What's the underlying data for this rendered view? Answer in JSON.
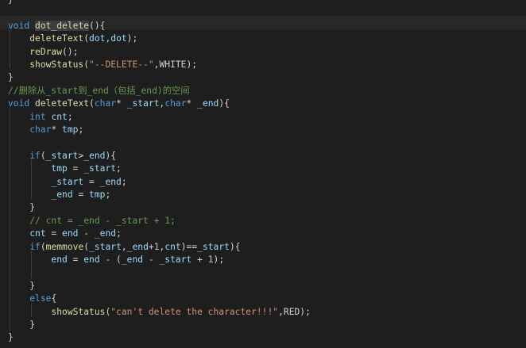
{
  "lines": [
    {
      "tokens": [
        {
          "t": "}",
          "c": "op"
        }
      ]
    },
    {
      "tokens": []
    },
    {
      "tokens": [
        {
          "t": "void",
          "c": "kw"
        },
        {
          "t": " ",
          "c": "op"
        },
        {
          "t": "dot_delete",
          "c": "fn hlword"
        },
        {
          "t": "(){",
          "c": "op"
        }
      ]
    },
    {
      "tokens": [
        {
          "t": "    ",
          "c": "op"
        },
        {
          "t": "deleteText",
          "c": "fn"
        },
        {
          "t": "(",
          "c": "op"
        },
        {
          "t": "dot",
          "c": "var"
        },
        {
          "t": ",",
          "c": "op"
        },
        {
          "t": "dot",
          "c": "var"
        },
        {
          "t": ");",
          "c": "op"
        }
      ]
    },
    {
      "tokens": [
        {
          "t": "    ",
          "c": "op"
        },
        {
          "t": "reDraw",
          "c": "fn"
        },
        {
          "t": "();",
          "c": "op"
        }
      ]
    },
    {
      "tokens": [
        {
          "t": "    ",
          "c": "op"
        },
        {
          "t": "showStatus",
          "c": "fn"
        },
        {
          "t": "(",
          "c": "op"
        },
        {
          "t": "\"--DELETE--\"",
          "c": "str"
        },
        {
          "t": ",WHITE);",
          "c": "op"
        }
      ]
    },
    {
      "tokens": [
        {
          "t": "}",
          "c": "op"
        }
      ]
    },
    {
      "tokens": [
        {
          "t": "//删除从_start到_end（包括_end)的空间",
          "c": "cm"
        }
      ]
    },
    {
      "tokens": [
        {
          "t": "void",
          "c": "kw"
        },
        {
          "t": " ",
          "c": "op"
        },
        {
          "t": "deleteText",
          "c": "fn"
        },
        {
          "t": "(",
          "c": "op"
        },
        {
          "t": "char",
          "c": "kw"
        },
        {
          "t": "* ",
          "c": "op"
        },
        {
          "t": "_start",
          "c": "var"
        },
        {
          "t": ",",
          "c": "op"
        },
        {
          "t": "char",
          "c": "kw"
        },
        {
          "t": "* ",
          "c": "op"
        },
        {
          "t": "_end",
          "c": "var"
        },
        {
          "t": "){",
          "c": "op"
        }
      ]
    },
    {
      "tokens": [
        {
          "t": "    ",
          "c": "op"
        },
        {
          "t": "int",
          "c": "kw"
        },
        {
          "t": " ",
          "c": "op"
        },
        {
          "t": "cnt",
          "c": "var"
        },
        {
          "t": ";",
          "c": "op"
        }
      ]
    },
    {
      "tokens": [
        {
          "t": "    ",
          "c": "op"
        },
        {
          "t": "char",
          "c": "kw"
        },
        {
          "t": "* ",
          "c": "op"
        },
        {
          "t": "tmp",
          "c": "var"
        },
        {
          "t": ";",
          "c": "op"
        }
      ]
    },
    {
      "tokens": []
    },
    {
      "tokens": [
        {
          "t": "    ",
          "c": "op"
        },
        {
          "t": "if",
          "c": "kw"
        },
        {
          "t": "(",
          "c": "op"
        },
        {
          "t": "_start",
          "c": "var"
        },
        {
          "t": ">",
          "c": "op"
        },
        {
          "t": "_end",
          "c": "var"
        },
        {
          "t": "){",
          "c": "op"
        }
      ]
    },
    {
      "tokens": [
        {
          "t": "        ",
          "c": "op"
        },
        {
          "t": "tmp",
          "c": "var"
        },
        {
          "t": " = ",
          "c": "op"
        },
        {
          "t": "_start",
          "c": "var"
        },
        {
          "t": ";",
          "c": "op"
        }
      ]
    },
    {
      "tokens": [
        {
          "t": "        ",
          "c": "op"
        },
        {
          "t": "_start",
          "c": "var"
        },
        {
          "t": " = ",
          "c": "op"
        },
        {
          "t": "_end",
          "c": "var"
        },
        {
          "t": ";",
          "c": "op"
        }
      ]
    },
    {
      "tokens": [
        {
          "t": "        ",
          "c": "op"
        },
        {
          "t": "_end",
          "c": "var"
        },
        {
          "t": " = ",
          "c": "op"
        },
        {
          "t": "tmp",
          "c": "var"
        },
        {
          "t": ";",
          "c": "op"
        }
      ]
    },
    {
      "tokens": [
        {
          "t": "    ",
          "c": "op"
        },
        {
          "t": "}",
          "c": "op"
        }
      ]
    },
    {
      "tokens": [
        {
          "t": "    ",
          "c": "op"
        },
        {
          "t": "// cnt = _end - _start + 1;",
          "c": "cm"
        }
      ]
    },
    {
      "tokens": [
        {
          "t": "    ",
          "c": "op"
        },
        {
          "t": "cnt",
          "c": "var"
        },
        {
          "t": " = ",
          "c": "op"
        },
        {
          "t": "end",
          "c": "var"
        },
        {
          "t": " - ",
          "c": "op"
        },
        {
          "t": "_end",
          "c": "var"
        },
        {
          "t": ";",
          "c": "op"
        }
      ]
    },
    {
      "tokens": [
        {
          "t": "    ",
          "c": "op"
        },
        {
          "t": "if",
          "c": "kw"
        },
        {
          "t": "(",
          "c": "op"
        },
        {
          "t": "memmove",
          "c": "fn"
        },
        {
          "t": "(",
          "c": "op"
        },
        {
          "t": "_start",
          "c": "var"
        },
        {
          "t": ",",
          "c": "op"
        },
        {
          "t": "_end",
          "c": "var"
        },
        {
          "t": "+",
          "c": "op"
        },
        {
          "t": "1",
          "c": "num"
        },
        {
          "t": ",",
          "c": "op"
        },
        {
          "t": "cnt",
          "c": "var"
        },
        {
          "t": ")==",
          "c": "op"
        },
        {
          "t": "_start",
          "c": "var"
        },
        {
          "t": "){",
          "c": "op"
        }
      ]
    },
    {
      "tokens": [
        {
          "t": "        ",
          "c": "op"
        },
        {
          "t": "end",
          "c": "var"
        },
        {
          "t": " = ",
          "c": "op"
        },
        {
          "t": "end",
          "c": "var"
        },
        {
          "t": " - (",
          "c": "op"
        },
        {
          "t": "_end",
          "c": "var"
        },
        {
          "t": " - ",
          "c": "op"
        },
        {
          "t": "_start",
          "c": "var"
        },
        {
          "t": " + ",
          "c": "op"
        },
        {
          "t": "1",
          "c": "num"
        },
        {
          "t": ");",
          "c": "op"
        }
      ]
    },
    {
      "tokens": []
    },
    {
      "tokens": [
        {
          "t": "    ",
          "c": "op"
        },
        {
          "t": "}",
          "c": "op"
        }
      ]
    },
    {
      "tokens": [
        {
          "t": "    ",
          "c": "op"
        },
        {
          "t": "else",
          "c": "kw"
        },
        {
          "t": "{",
          "c": "op"
        }
      ]
    },
    {
      "tokens": [
        {
          "t": "        ",
          "c": "op"
        },
        {
          "t": "showStatus",
          "c": "fn"
        },
        {
          "t": "(",
          "c": "op"
        },
        {
          "t": "\"can't delete the character!!!\"",
          "c": "str"
        },
        {
          "t": ",RED);",
          "c": "op"
        }
      ]
    },
    {
      "tokens": [
        {
          "t": "    ",
          "c": "op"
        },
        {
          "t": "}",
          "c": "op"
        }
      ]
    },
    {
      "tokens": [
        {
          "t": "}",
          "c": "op"
        }
      ]
    }
  ],
  "colors": {
    "background": "#1e1e1e",
    "keyword": "#569cd6",
    "function": "#dcdcaa",
    "variable": "#9cdcfe",
    "string": "#ce9178",
    "number": "#b5cea8",
    "comment": "#6a9955"
  }
}
